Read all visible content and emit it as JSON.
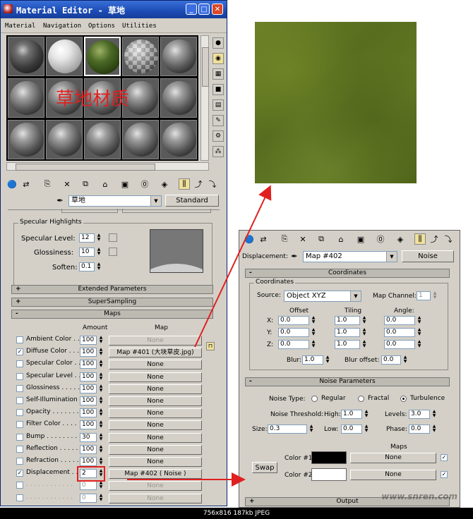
{
  "window": {
    "title": "Material Editor - 草地"
  },
  "menu": [
    "Material",
    "Navigation",
    "Options",
    "Utilities"
  ],
  "overlay_text": "草地材质",
  "material": {
    "name": "草地",
    "type": "Standard"
  },
  "specular": {
    "group_title": "Specular Highlights",
    "level_label": "Specular Level:",
    "level_value": "12",
    "gloss_label": "Glossiness:",
    "gloss_value": "10",
    "soften_label": "Soften:",
    "soften_value": "0.1"
  },
  "rollouts": {
    "extended": "Extended Parameters",
    "supersampling": "SuperSampling",
    "maps": "Maps"
  },
  "maps": {
    "amount_header": "Amount",
    "map_header": "Map",
    "rows": [
      {
        "label": "Ambient Color . . .",
        "amount": "100",
        "map": "None",
        "checked": false,
        "dim_map": true
      },
      {
        "label": "Diffuse Color . . .",
        "amount": "100",
        "map": "Map #401 (大块草皮.jpg)",
        "checked": true,
        "dim_map": false
      },
      {
        "label": "Specular Color . .",
        "amount": "100",
        "map": "None",
        "checked": false,
        "dim_map": false
      },
      {
        "label": "Specular Level . .",
        "amount": "100",
        "map": "None",
        "checked": false,
        "dim_map": false
      },
      {
        "label": "Glossiness . . . . .",
        "amount": "100",
        "map": "None",
        "checked": false,
        "dim_map": false
      },
      {
        "label": "Self-Illumination .",
        "amount": "100",
        "map": "None",
        "checked": false,
        "dim_map": false
      },
      {
        "label": "Opacity . . . . . . .",
        "amount": "100",
        "map": "None",
        "checked": false,
        "dim_map": false
      },
      {
        "label": "Filter Color . . . .",
        "amount": "100",
        "map": "None",
        "checked": false,
        "dim_map": false
      },
      {
        "label": "Bump . . . . . . . .",
        "amount": "30",
        "map": "None",
        "checked": false,
        "dim_map": false
      },
      {
        "label": "Reflection . . . . .",
        "amount": "100",
        "map": "None",
        "checked": false,
        "dim_map": false
      },
      {
        "label": "Refraction . . . . .",
        "amount": "100",
        "map": "None",
        "checked": false,
        "dim_map": false
      },
      {
        "label": "Displacement . . .",
        "amount": "2",
        "map": "Map #402 ( Noise )",
        "checked": true,
        "dim_map": false
      },
      {
        "label": ". . . . . . . . . . . .",
        "amount": "0",
        "map": "None",
        "checked": false,
        "dim_map": true
      },
      {
        "label": ". . . . . . . . . . . .",
        "amount": "0",
        "map": "None",
        "checked": false,
        "dim_map": true
      }
    ]
  },
  "noise_panel": {
    "slot_label": "Displacement:",
    "map_name": "Map #402",
    "type_button": "Noise",
    "coordinates_title": "Coordinates",
    "coordinates_group": "Coordinates",
    "source_label": "Source:",
    "source_value": "Object XYZ",
    "channel_label": "Map Channel:",
    "channel_value": "1",
    "offset_header": "Offset",
    "tiling_header": "Tiling",
    "angle_header": "Angle:",
    "axes": [
      {
        "label": "X:",
        "offset": "0.0",
        "tiling": "1.0",
        "angle": "0.0"
      },
      {
        "label": "Y:",
        "offset": "0.0",
        "tiling": "1.0",
        "angle": "0.0"
      },
      {
        "label": "Z:",
        "offset": "0.0",
        "tiling": "1.0",
        "angle": "0.0"
      }
    ],
    "blur_label": "Blur:",
    "blur_value": "1.0",
    "blur_offset_label": "Blur offset:",
    "blur_offset_value": "0.0",
    "noise_title": "Noise Parameters",
    "noise_type_label": "Noise Type:",
    "types": [
      "Regular",
      "Fractal",
      "Turbulence"
    ],
    "selected_type": "Turbulence",
    "threshold_label": "Noise Threshold:",
    "high_label": "High:",
    "high_value": "1.0",
    "levels_label": "Levels:",
    "levels_value": "3.0",
    "size_label": "Size:",
    "size_value": "0.3",
    "low_label": "Low:",
    "low_value": "0.0",
    "phase_label": "Phase:",
    "phase_value": "0.0",
    "maps_header": "Maps",
    "swap": "Swap",
    "color1_label": "Color #1",
    "color1": "#000000",
    "color1_map": "None",
    "color2_label": "Color #2",
    "color2": "#ffffff",
    "color2_map": "None",
    "output_title": "Output"
  },
  "colors": {
    "arrow": "#e02020",
    "overlay_text": "#e02020",
    "highlight_box": "#e02020"
  },
  "status": "756x816  187kb  JPEG",
  "watermark": "www.snren.com"
}
